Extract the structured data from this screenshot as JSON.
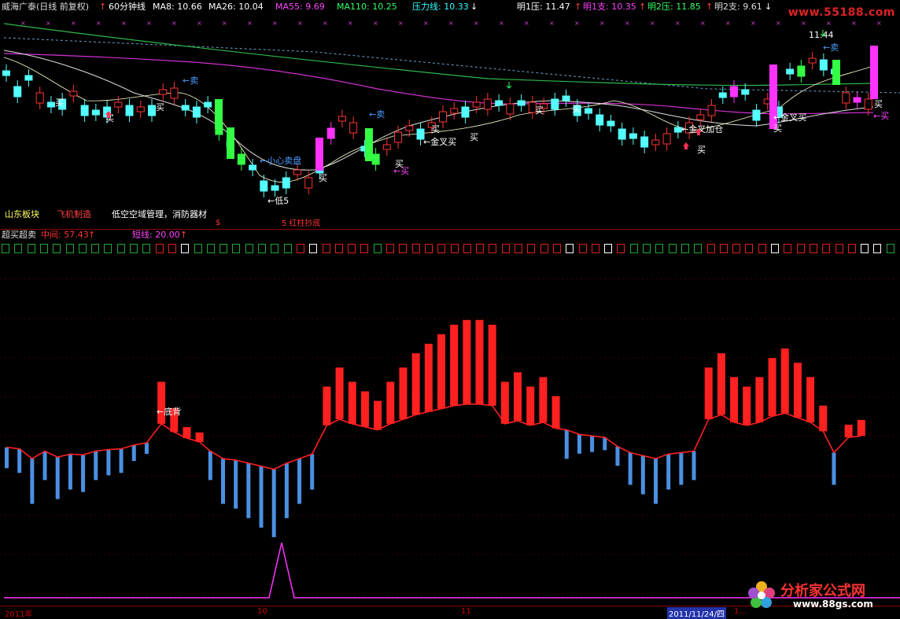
{
  "header": {
    "stock": "威海广泰(日线 前复权)",
    "period": "60分钟线",
    "ma8": "MA8: 10.66",
    "ma26": "MA26: 10.04",
    "ma55": "MA55: 9.69",
    "ma110": "MA110: 10.25",
    "pressure": "压力线: 10.33",
    "p1": "明1压: 11.47",
    "s1": "明1支: 10.35",
    "p2": "明2压: 11.85",
    "s2": "明2支: 9.61",
    "watermark": "www.55188.com"
  },
  "tags": {
    "region": "山东板块",
    "industry": "飞机制造",
    "concept": "低空空域管理，消防器材",
    "small_signal": "5 红柱抄底"
  },
  "annotations": {
    "sell1": "←卖",
    "sell2": "←卖",
    "sell3": "←卖",
    "sell4": "←卖",
    "buy_label": "买",
    "buy_arrow": "←买",
    "careful": "←小心卖盘",
    "cross_buy": "←金叉买",
    "cross_buy2": "←金叉买",
    "cross_add": "←金叉加仓",
    "low_price": "←低5",
    "high_price": "11.44",
    "bottom_div": "←底背"
  },
  "sub": {
    "title": "超买超卖",
    "mid": "中间: 57.43",
    "short": "短线: 20.00"
  },
  "signal_squares": [
    "g",
    "g",
    "g",
    "g",
    "g",
    "g",
    "g",
    "g",
    "g",
    "g",
    "g",
    "g",
    "r",
    "r",
    "w",
    "g",
    "g",
    "g",
    "g",
    "g",
    "g",
    "g",
    "g",
    "r",
    "w",
    "r",
    "r",
    "r",
    "r",
    "g",
    "r",
    "r",
    "r",
    "r",
    "r",
    "r",
    "r",
    "r",
    "r",
    "r",
    "r",
    "r",
    "r",
    "r",
    "w",
    "r",
    "r",
    "w",
    "r",
    "g",
    "g",
    "g",
    "g",
    "g",
    "g",
    "r",
    "r",
    "r",
    "r",
    "r",
    "w",
    "r",
    "r",
    "r",
    "r",
    "r",
    "r",
    "w",
    "w",
    "g"
  ],
  "oscillator": {
    "bars": [
      {
        "v": -0.45,
        "c": "blue"
      },
      {
        "v": -0.55,
        "c": "blue"
      },
      {
        "v": -1.2,
        "c": "blue"
      },
      {
        "v": -0.7,
        "c": "blue"
      },
      {
        "v": -1.1,
        "c": "blue"
      },
      {
        "v": -0.9,
        "c": "blue"
      },
      {
        "v": -0.95,
        "c": "blue"
      },
      {
        "v": -0.7,
        "c": "blue"
      },
      {
        "v": -0.6,
        "c": "blue"
      },
      {
        "v": -0.55,
        "c": "blue"
      },
      {
        "v": -0.3,
        "c": "blue"
      },
      {
        "v": -0.15,
        "c": "blue"
      },
      {
        "v": 1.1,
        "c": "red"
      },
      {
        "v": 0.55,
        "c": "red"
      },
      {
        "v": 0.15,
        "c": "red"
      },
      {
        "v": -0.1,
        "c": "red"
      },
      {
        "v": -0.7,
        "c": "blue"
      },
      {
        "v": -1.2,
        "c": "blue"
      },
      {
        "v": -1.3,
        "c": "blue"
      },
      {
        "v": -1.5,
        "c": "blue"
      },
      {
        "v": -1.7,
        "c": "blue"
      },
      {
        "v": -1.9,
        "c": "blue"
      },
      {
        "v": -1.5,
        "c": "blue"
      },
      {
        "v": -1.2,
        "c": "blue"
      },
      {
        "v": -0.9,
        "c": "blue"
      },
      {
        "v": 1.0,
        "c": "red"
      },
      {
        "v": 1.4,
        "c": "red"
      },
      {
        "v": 1.1,
        "c": "red"
      },
      {
        "v": 0.9,
        "c": "red"
      },
      {
        "v": 0.7,
        "c": "red"
      },
      {
        "v": 1.1,
        "c": "red"
      },
      {
        "v": 1.4,
        "c": "red"
      },
      {
        "v": 1.7,
        "c": "red"
      },
      {
        "v": 1.9,
        "c": "red"
      },
      {
        "v": 2.1,
        "c": "red"
      },
      {
        "v": 2.3,
        "c": "red"
      },
      {
        "v": 2.4,
        "c": "red"
      },
      {
        "v": 2.4,
        "c": "red"
      },
      {
        "v": 2.3,
        "c": "red"
      },
      {
        "v": 1.1,
        "c": "red"
      },
      {
        "v": 1.3,
        "c": "red"
      },
      {
        "v": 1.0,
        "c": "red"
      },
      {
        "v": 1.2,
        "c": "red"
      },
      {
        "v": 0.8,
        "c": "red"
      },
      {
        "v": 0.7,
        "c": "blue"
      },
      {
        "v": 0.4,
        "c": "blue"
      },
      {
        "v": 0.3,
        "c": "blue"
      },
      {
        "v": 0.2,
        "c": "blue"
      },
      {
        "v": -0.4,
        "c": "blue"
      },
      {
        "v": -0.8,
        "c": "blue"
      },
      {
        "v": -1.0,
        "c": "blue"
      },
      {
        "v": -1.2,
        "c": "blue"
      },
      {
        "v": -0.9,
        "c": "blue"
      },
      {
        "v": -0.8,
        "c": "blue"
      },
      {
        "v": -0.7,
        "c": "blue"
      },
      {
        "v": 1.4,
        "c": "red"
      },
      {
        "v": 1.7,
        "c": "red"
      },
      {
        "v": 1.2,
        "c": "red"
      },
      {
        "v": 1.0,
        "c": "red"
      },
      {
        "v": 1.2,
        "c": "red"
      },
      {
        "v": 1.6,
        "c": "red"
      },
      {
        "v": 1.8,
        "c": "red"
      },
      {
        "v": 1.5,
        "c": "red"
      },
      {
        "v": 1.2,
        "c": "red"
      },
      {
        "v": 0.6,
        "c": "red"
      },
      {
        "v": -0.8,
        "c": "blue"
      },
      {
        "v": 0.2,
        "c": "red"
      },
      {
        "v": 0.3,
        "c": "red"
      }
    ]
  },
  "time_axis": {
    "year": "2011年",
    "m10": "10",
    "m11": "11",
    "date": "2011/11/24/四",
    "tail": "1..."
  },
  "logo": {
    "text": "分析家公式网",
    "url": "www.88gs.com"
  },
  "colors": {
    "bg": "#000000",
    "up": "#ff3333",
    "down": "#54ffff",
    "red_bar": "#ff2020",
    "blue_bar": "#4a90e2",
    "magenta": "#ff33ff",
    "grid_red": "#8a0000"
  }
}
